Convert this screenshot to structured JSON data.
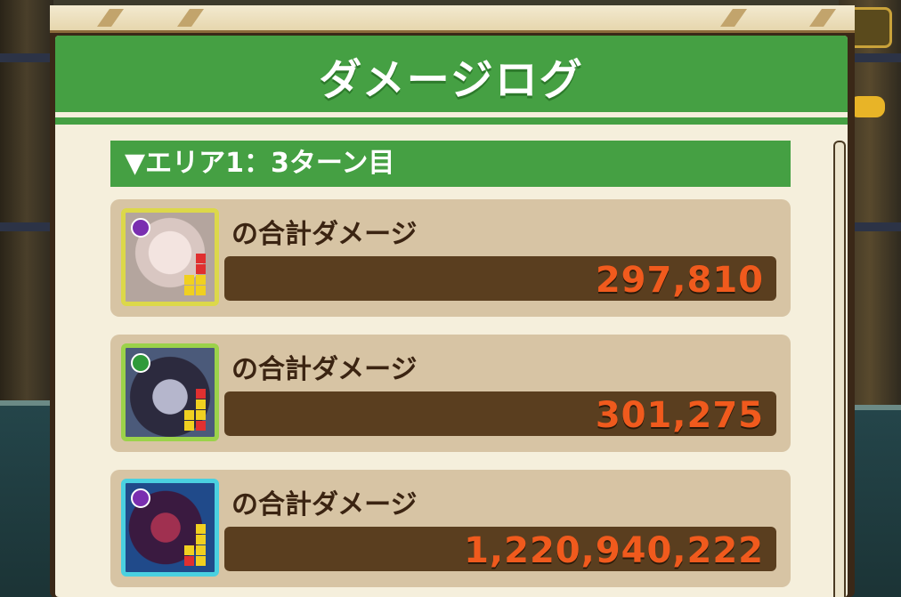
{
  "dialog": {
    "title": "ダメージログ"
  },
  "area": {
    "header": "▼エリア1：3ターン目"
  },
  "entries": [
    {
      "label": "の合計ダメージ",
      "damage": "297,810",
      "attribute_color": "#7a2fb0"
    },
    {
      "label": "の合計ダメージ",
      "damage": "301,275",
      "attribute_color": "#2f9a3a"
    },
    {
      "label": "の合計ダメージ",
      "damage": "1,220,940,222",
      "attribute_color": "#7a2fb0"
    }
  ],
  "colors": {
    "header_green": "#45a043",
    "panel_bg": "#f5efdc",
    "entry_bg": "#d7c4a4",
    "damage_bar": "#5a3e1f",
    "damage_text": "#f05a1d"
  }
}
